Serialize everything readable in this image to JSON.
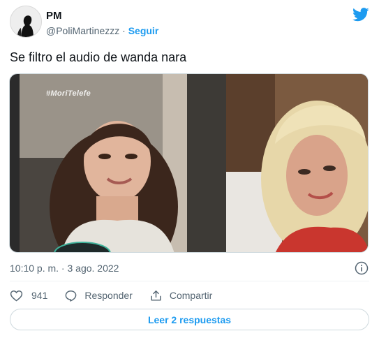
{
  "author": {
    "display_name": "PM",
    "handle": "@PoliMartinezzz",
    "separator": "·",
    "follow_label": "Seguir",
    "avatar_icon": "silhouette-avatar"
  },
  "brand": {
    "icon": "twitter-bird-icon",
    "color": "#1d9bf0"
  },
  "tweet": {
    "text": "Se filtro el audio de wanda nara"
  },
  "media": {
    "watermark": "#MoriTelefe",
    "description_icon": "two-panel-photo"
  },
  "meta": {
    "timestamp": "10:10 p. m. · 3 ago. 2022",
    "info_icon": "info-icon"
  },
  "actions": {
    "like_count": "941",
    "reply_label": "Responder",
    "share_label": "Compartir"
  },
  "replies": {
    "label": "Leer 2 respuestas"
  },
  "colors": {
    "accent": "#1d9bf0",
    "text": "#0f1419",
    "muted": "#536471",
    "border": "#cfd9de"
  }
}
